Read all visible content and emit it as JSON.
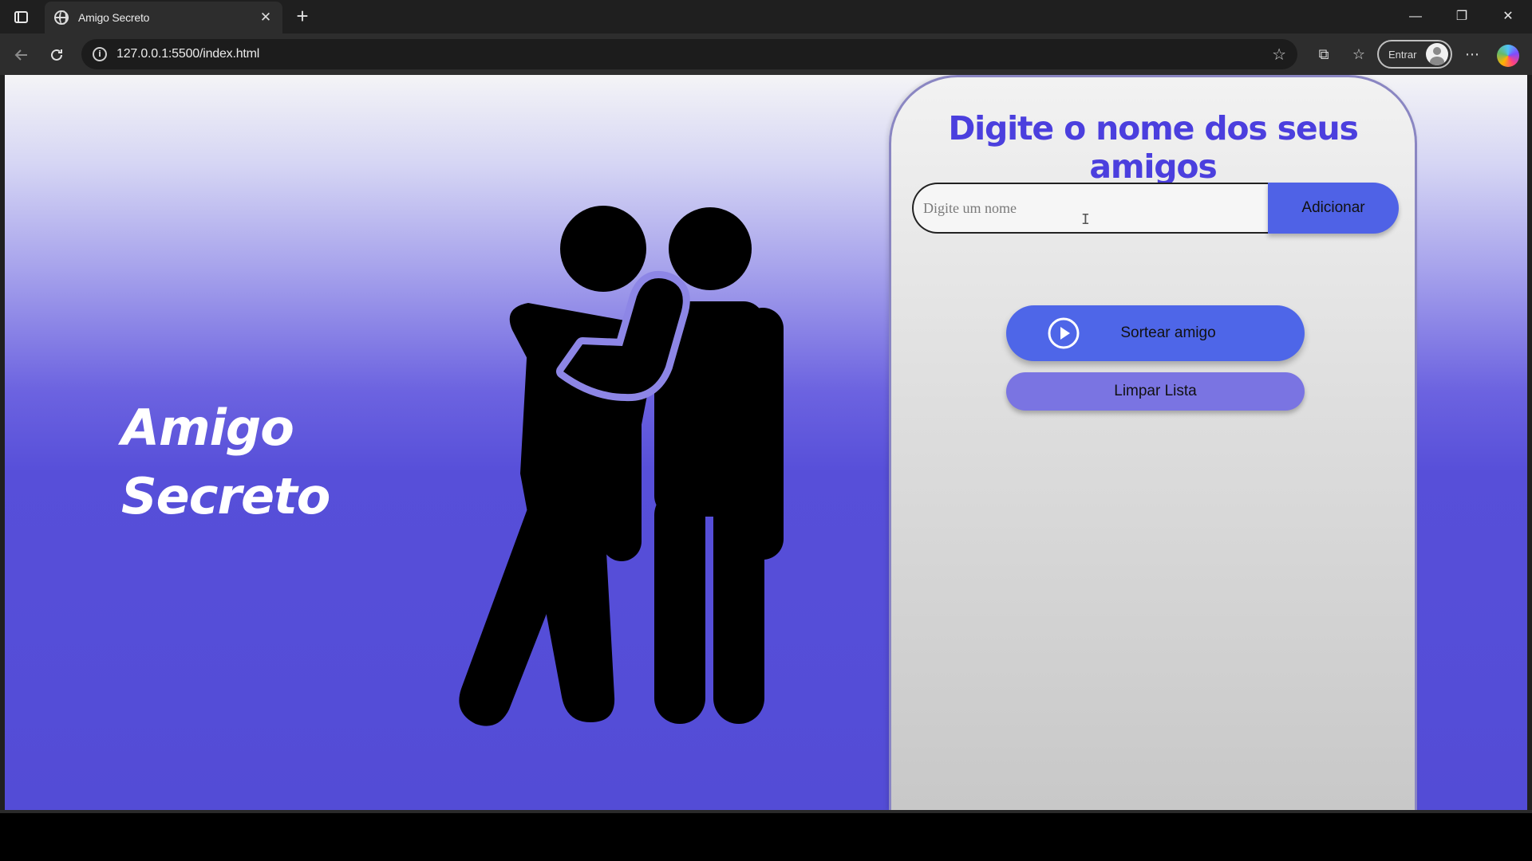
{
  "browser": {
    "tab_title": "Amigo Secreto",
    "tab_close": "✕",
    "new_tab": "+",
    "url": "127.0.0.1:5500/index.html",
    "signin_label": "Entrar",
    "window_controls": {
      "minimize": "—",
      "restore": "❐",
      "close": "✕"
    },
    "icons": [
      "sidebar-toggle-icon",
      "globe-icon",
      "back-icon",
      "reload-icon",
      "site-info-icon",
      "favorite-star-icon",
      "extensions-icon",
      "favorites-icon",
      "profile-icon",
      "more-icon",
      "copilot-icon"
    ]
  },
  "page": {
    "brand_line1": "Amigo",
    "brand_line2": "Secreto",
    "card_title": "Digite o nome dos seus amigos",
    "input_placeholder": "Digite um nome",
    "input_value": "",
    "add_button": "Adicionar",
    "draw_button": "Sortear amigo",
    "clear_button": "Limpar Lista"
  },
  "colors": {
    "accent": "#4b3fde",
    "button_primary": "#4e66e8",
    "button_secondary": "#7a74e2",
    "background_bottom": "#534cd6"
  }
}
